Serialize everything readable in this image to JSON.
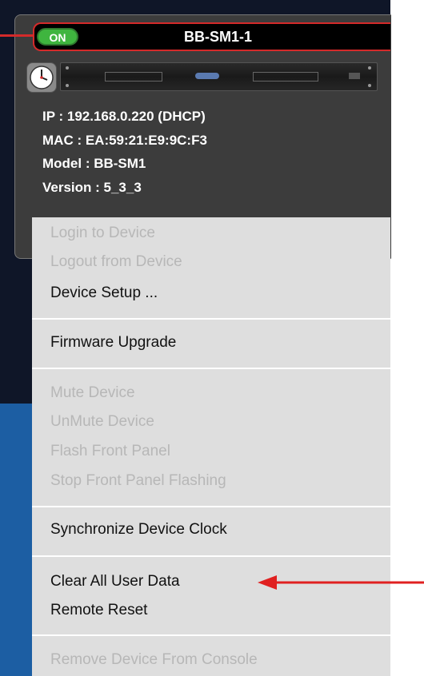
{
  "device": {
    "status": "ON",
    "name": "BB-SM1-1",
    "ip": "IP : 192.168.0.220 (DHCP)",
    "mac": "MAC : EA:59:21:E9:9C:F3",
    "model": "Model : BB-SM1",
    "version": "Version : 5_3_3"
  },
  "menu": {
    "items": [
      {
        "label": "Login to Device",
        "enabled": false
      },
      {
        "label": "Logout from Device",
        "enabled": false
      },
      {
        "label": "Device Setup ...",
        "enabled": true
      },
      {
        "label": "Firmware Upgrade",
        "enabled": true
      },
      {
        "label": "Mute Device",
        "enabled": false
      },
      {
        "label": "UnMute Device",
        "enabled": false
      },
      {
        "label": "Flash Front Panel",
        "enabled": false
      },
      {
        "label": "Stop Front Panel Flashing",
        "enabled": false
      },
      {
        "label": "Synchronize Device Clock",
        "enabled": true
      },
      {
        "label": "Clear All User Data",
        "enabled": true
      },
      {
        "label": "Remote Reset",
        "enabled": true
      },
      {
        "label": "Remove Device From Console",
        "enabled": false
      }
    ]
  },
  "colors": {
    "status_on": "#3fb53f",
    "highlight_border": "#d42a2a",
    "arrow": "#e02020",
    "menu_bg": "#dedede",
    "disabled_text": "#b7b7b7"
  },
  "icons": [
    "clock-icon",
    "rack-unit-image",
    "arrow-annotation"
  ]
}
